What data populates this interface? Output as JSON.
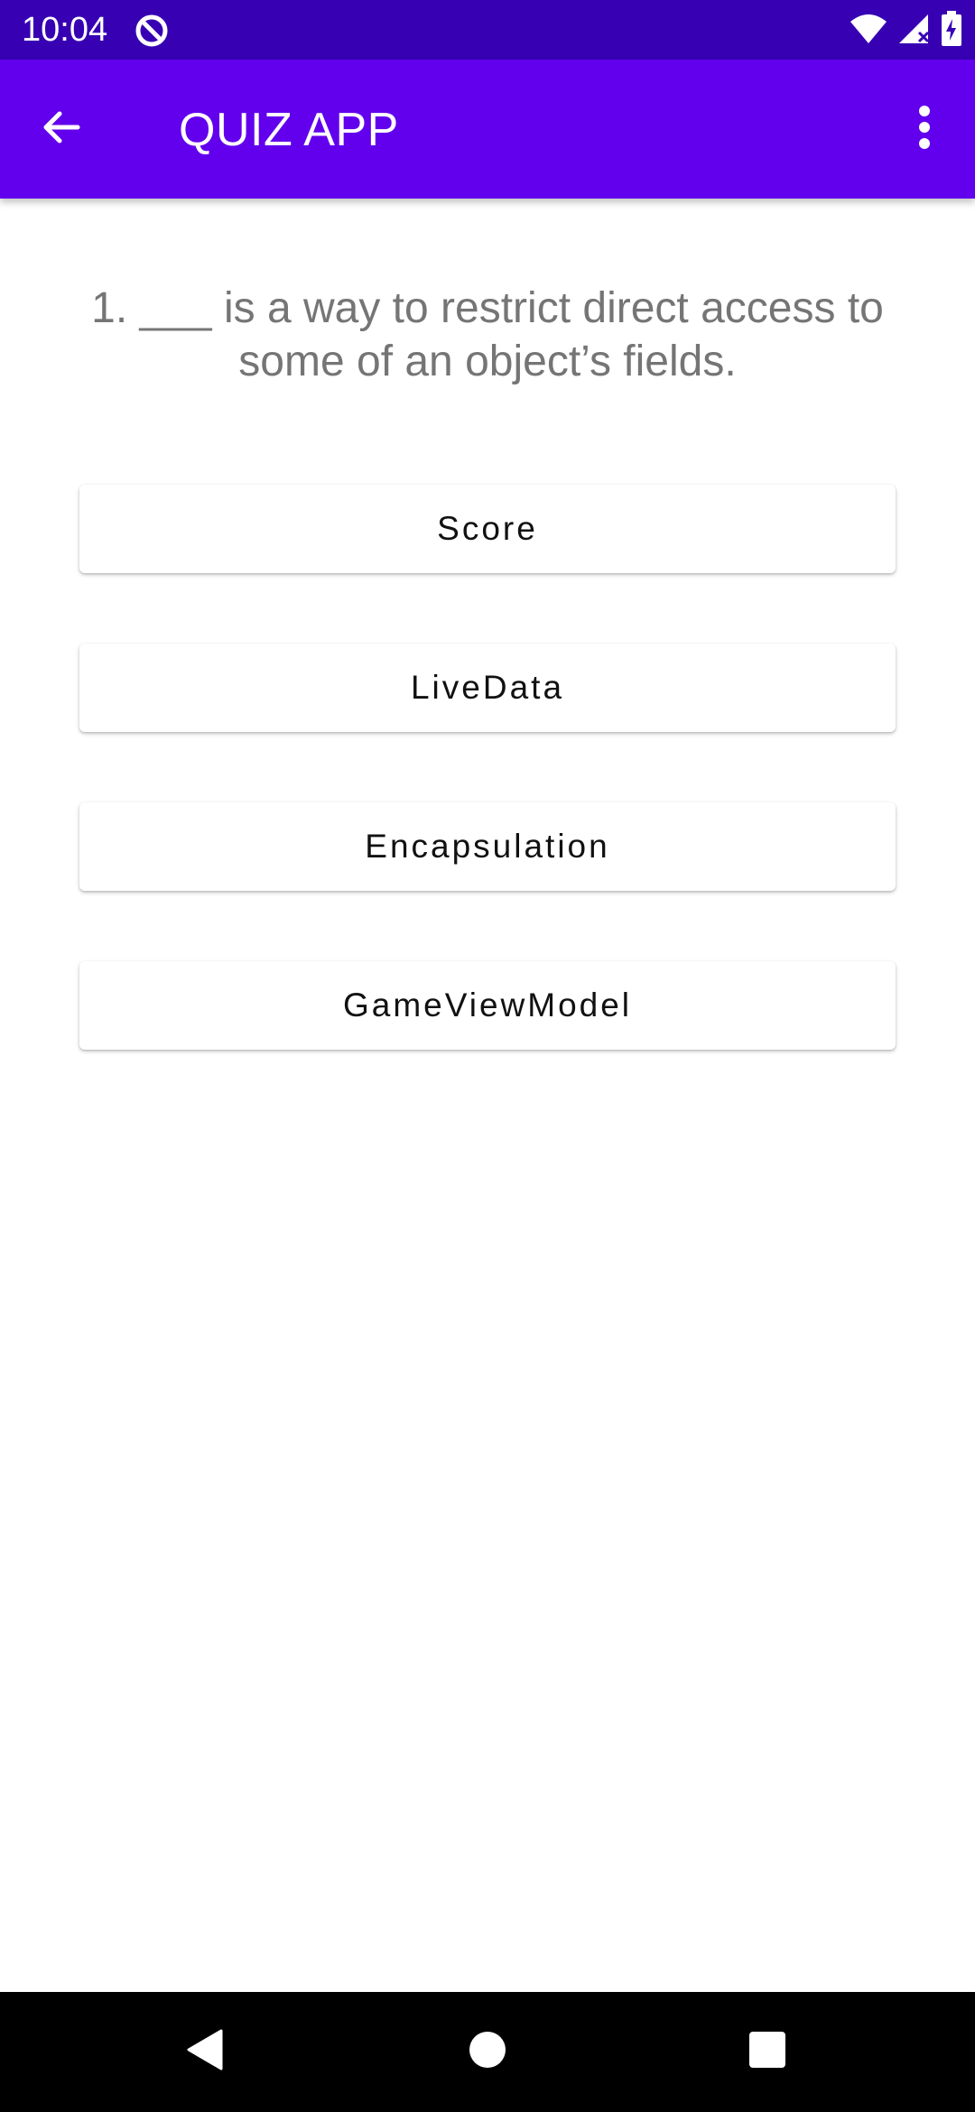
{
  "status_bar": {
    "time": "10:04",
    "icons": [
      "app-notification-icon",
      "wifi-icon",
      "signal-icon",
      "battery-charging-icon"
    ],
    "background": "#3700b3"
  },
  "app_bar": {
    "title": "QUIZ APP",
    "back_icon": "arrow-back-icon",
    "menu_icon": "more-vert-icon",
    "background": "#6200ee"
  },
  "quiz": {
    "question": "1. ___ is a way to restrict direct access to some of an object’s fields.",
    "answers": [
      {
        "label": "Score"
      },
      {
        "label": "LiveData"
      },
      {
        "label": "Encapsulation"
      },
      {
        "label": "GameViewModel"
      }
    ]
  },
  "nav_bar": {
    "buttons": [
      "back-icon",
      "home-icon",
      "recents-icon"
    ],
    "background": "#000000"
  }
}
